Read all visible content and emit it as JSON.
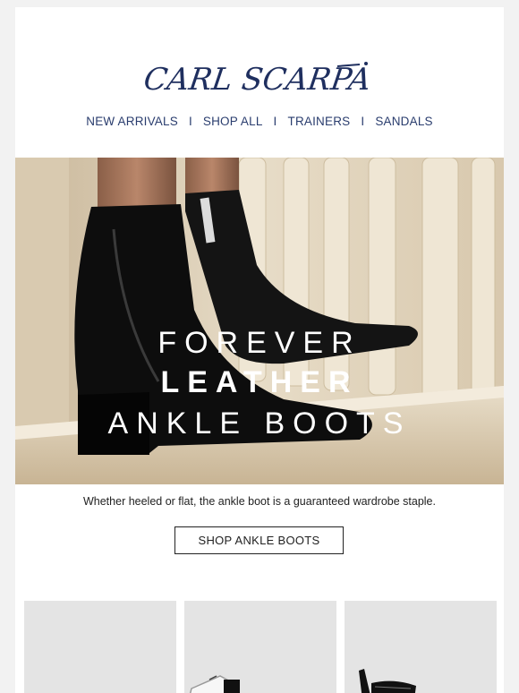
{
  "brand": {
    "logo_text": "CARL SCARPA"
  },
  "nav": {
    "items": [
      "NEW ARRIVALS",
      "SHOP ALL",
      "TRAINERS",
      "SANDALS"
    ],
    "separator": "I"
  },
  "hero": {
    "line1": "FOREVER",
    "line2": "LEATHER",
    "line3": "ANKLE BOOTS",
    "boot_brand_tag": "Carl Scarpa"
  },
  "tagline": "Whether heeled or flat, the ankle boot is a guaranteed wardrobe staple.",
  "cta": {
    "label": "SHOP ANKLE BOOTS"
  },
  "products": [
    {
      "image": "product-image-1"
    },
    {
      "image": "product-image-2"
    },
    {
      "image": "product-image-3"
    }
  ],
  "colors": {
    "brand_navy": "#1f2f5f",
    "nav_text": "#2a3d6e",
    "text": "#222222"
  }
}
